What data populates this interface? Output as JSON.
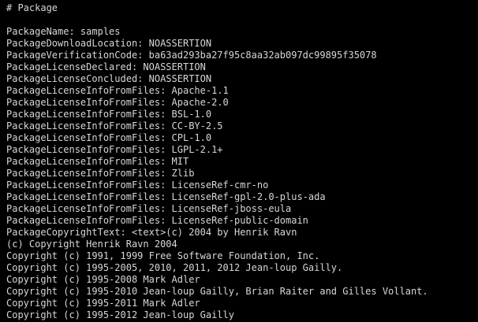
{
  "lines": [
    "# Package",
    "",
    "PackageName: samples",
    "PackageDownloadLocation: NOASSERTION",
    "PackageVerificationCode: ba63ad293ba27f95c8aa32ab097dc99895f35078",
    "PackageLicenseDeclared: NOASSERTION",
    "PackageLicenseConcluded: NOASSERTION",
    "PackageLicenseInfoFromFiles: Apache-1.1",
    "PackageLicenseInfoFromFiles: Apache-2.0",
    "PackageLicenseInfoFromFiles: BSL-1.0",
    "PackageLicenseInfoFromFiles: CC-BY-2.5",
    "PackageLicenseInfoFromFiles: CPL-1.0",
    "PackageLicenseInfoFromFiles: LGPL-2.1+",
    "PackageLicenseInfoFromFiles: MIT",
    "PackageLicenseInfoFromFiles: Zlib",
    "PackageLicenseInfoFromFiles: LicenseRef-cmr-no",
    "PackageLicenseInfoFromFiles: LicenseRef-gpl-2.0-plus-ada",
    "PackageLicenseInfoFromFiles: LicenseRef-jboss-eula",
    "PackageLicenseInfoFromFiles: LicenseRef-public-domain",
    "PackageCopyrightText: <text>(c) 2004 by Henrik Ravn",
    "(c) Copyright Henrik Ravn 2004",
    "Copyright (c) 1991, 1999 Free Software Foundation, Inc.",
    "Copyright (c) 1995-2005, 2010, 2011, 2012 Jean-loup Gailly.",
    "Copyright (c) 1995-2008 Mark Adler",
    "Copyright (c) 1995-2010 Jean-loup Gailly, Brian Raiter and Gilles Vollant.",
    "Copyright (c) 1995-2011 Mark Adler",
    "Copyright (c) 1995-2012 Jean-loup Gailly"
  ],
  "colors": {
    "background": "#000000",
    "text": "#d7d7d7"
  }
}
